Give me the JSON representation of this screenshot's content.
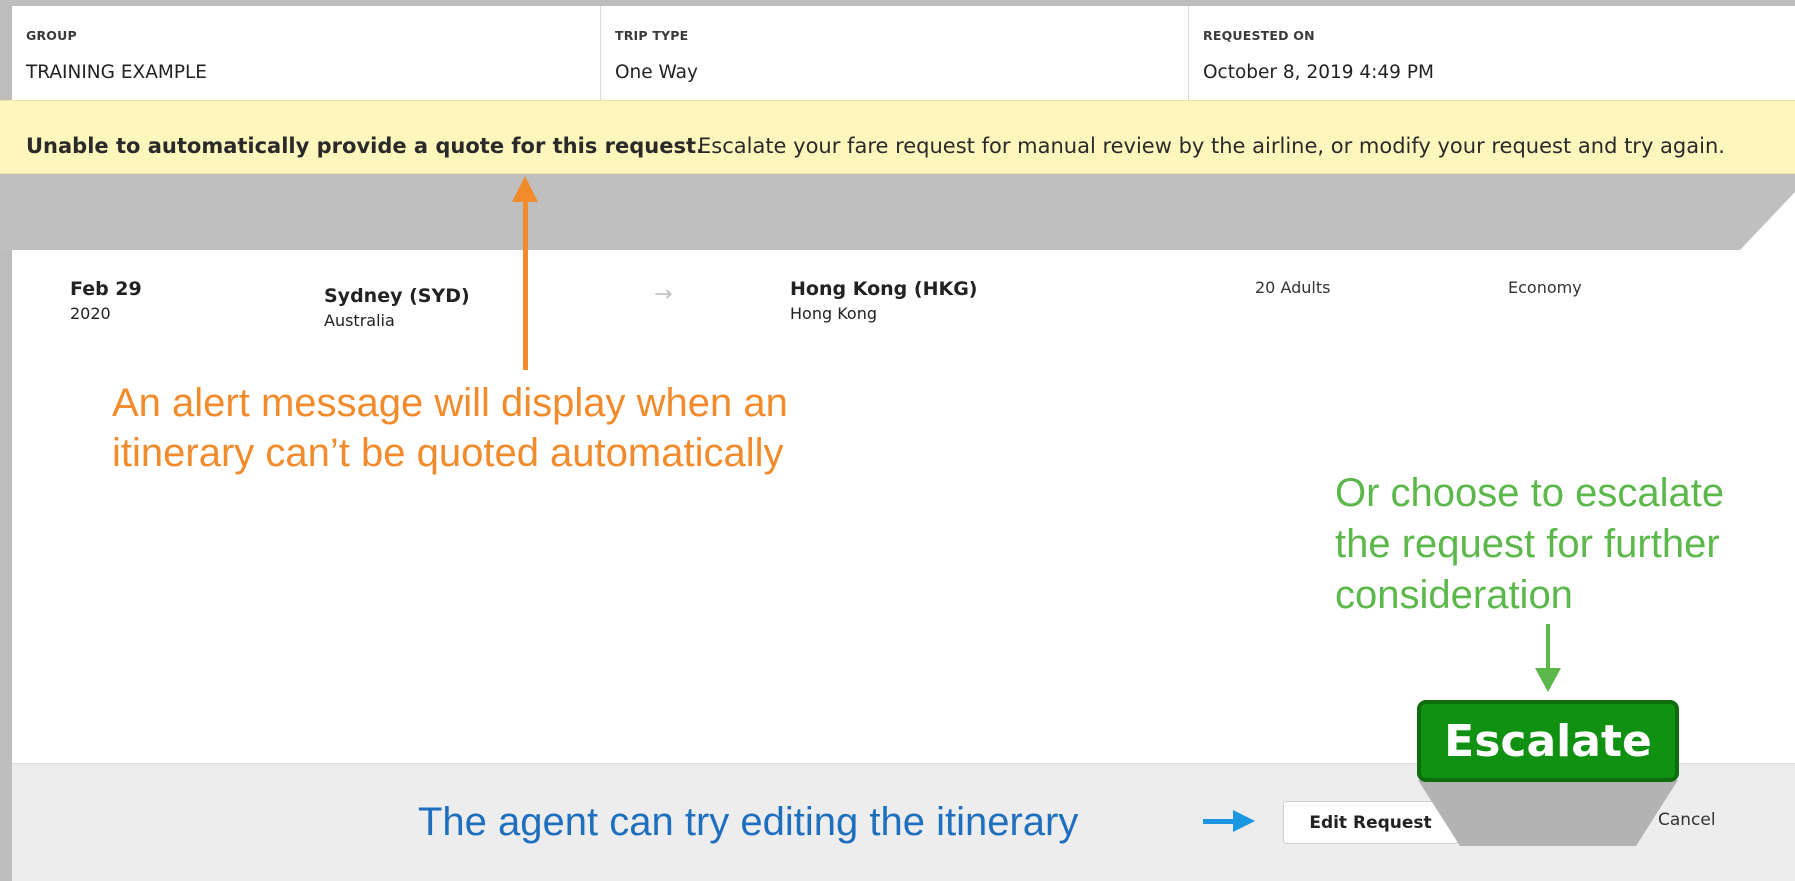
{
  "summary": {
    "group": {
      "label": "GROUP",
      "value": "TRAINING EXAMPLE"
    },
    "trip_type": {
      "label": "TRIP TYPE",
      "value": "One Way"
    },
    "requested_on": {
      "label": "REQUESTED ON",
      "value": "October 8, 2019 4:49 PM"
    }
  },
  "alert": {
    "bold_text": "Unable to automatically provide a quote for this request.",
    "text": "Escalate your fare request for manual review by  the airline, or modify your request and try again."
  },
  "itinerary": {
    "date_day": "Feb 29",
    "date_year": "2020",
    "origin_city": "Sydney (SYD)",
    "origin_country": "Australia",
    "arrow": "→",
    "destination_city": "Hong Kong (HKG)",
    "destination_country": "Hong Kong",
    "passengers": "20 Adults",
    "cabin": "Economy"
  },
  "annotations": {
    "alert_note": "An alert message will display when an itinerary can’t be quoted automatically",
    "escalate_note": "Or choose to escalate the request for further consideration",
    "edit_note": "The agent can try editing the itinerary",
    "alert_color": "#f28b2c",
    "escalate_color": "#5cb84a",
    "edit_color": "#1f6fbf"
  },
  "actions": {
    "edit_label": "Edit Request",
    "escalate_label": "Escalate",
    "cancel_label": "Cancel"
  }
}
